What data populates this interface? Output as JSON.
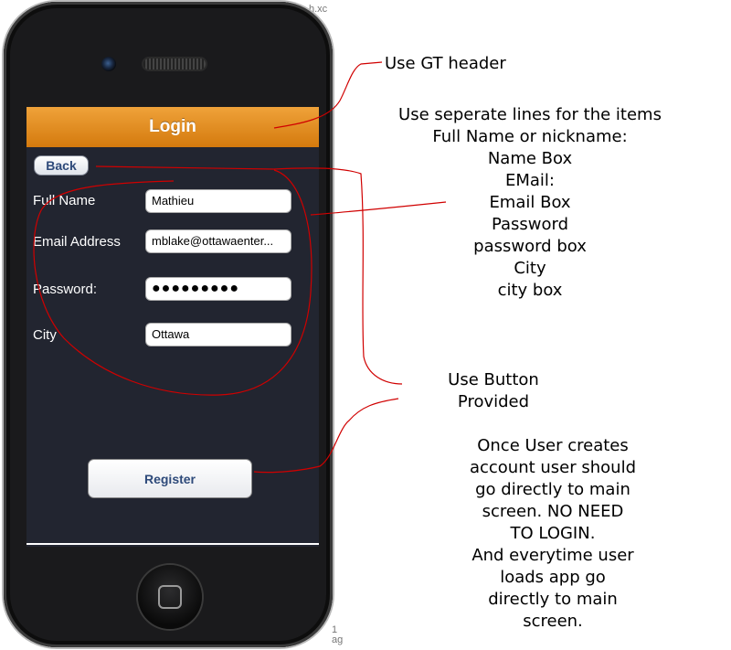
{
  "screen": {
    "title": "Login",
    "back_label": "Back",
    "fields": [
      {
        "label": "Full Name",
        "value": "Mathieu"
      },
      {
        "label": "Email Address",
        "value": "mblake@ottawaenter..."
      },
      {
        "label": "Password:",
        "value": "●●●●●●●●●"
      },
      {
        "label": "City",
        "value": "Ottawa"
      }
    ],
    "register_label": "Register"
  },
  "annotations": {
    "header_note": "Use GT header",
    "fields_note": "Use seperate lines for  the items\nFull Name or nickname:\nName Box\nEMail:\nEmail Box\nPassword\npassword box\nCity\ncity box",
    "button_note": "Use Button\nProvided",
    "flow_note": "Once User creates\naccount user should\ngo directly to main\nscreen. NO NEED\nTO LOGIN.\nAnd everytime user\nloads app go\ndirectly to main\nscreen."
  },
  "background_fragments": {
    "top": "h.xc",
    "bottom": "1\nag"
  },
  "colors": {
    "navbar": "#e8901f",
    "screen_bg": "#222530",
    "annotation_ink": "#d00000"
  }
}
